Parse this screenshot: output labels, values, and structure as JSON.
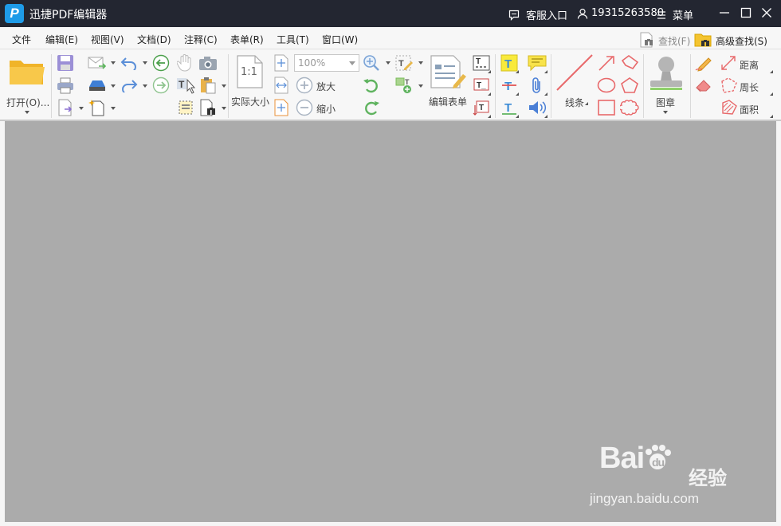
{
  "app": {
    "logo_letter": "P",
    "title": "迅捷PDF编辑器"
  },
  "titlebar": {
    "service_label": "客服入口",
    "user_label": "19315263580",
    "menu_label": "菜单"
  },
  "menubar": {
    "items": [
      "文件",
      "编辑(E)",
      "视图(V)",
      "文档(D)",
      "注释(C)",
      "表单(R)",
      "工具(T)",
      "窗口(W)"
    ],
    "find_label": "查找(F)",
    "adv_find_label": "高级查找(S)"
  },
  "toolbar": {
    "open_label": "打开(O)...",
    "actual_size_glyph": "1:1",
    "actual_size_label": "实际大小",
    "zoom_value": "100%",
    "zoom_in_label": "放大",
    "zoom_out_label": "缩小",
    "edit_form_label": "编辑表单",
    "lines_label": "线条",
    "stamp_label": "图章",
    "distance_label": "距离",
    "perimeter_label": "周长",
    "area_label": "面积"
  },
  "watermark": {
    "brand_a": "Bai",
    "brand_b": "du",
    "brand_cn": "经验",
    "url": "jingyan.baidu.com"
  },
  "colors": {
    "titlebar_bg": "#232631",
    "workspace_bg": "#ababab",
    "accent_blue": "#1e9be8",
    "annotation_red": "#e8696b"
  }
}
